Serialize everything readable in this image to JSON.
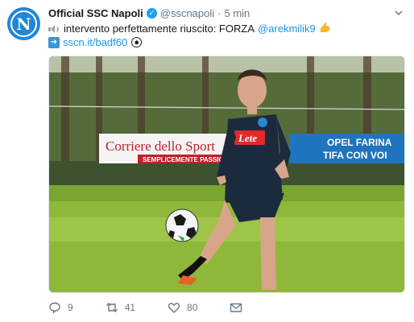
{
  "tweet": {
    "display_name": "Official SSC Napoli",
    "handle": "@sscnapoli",
    "separator": "·",
    "time": "5 min",
    "avatar_letter": "N",
    "text_line1": "intervento perfettamente riuscito: FORZA",
    "mention": "@arekmilik9",
    "link": "sscn.it/badf60"
  },
  "media": {
    "banner_left": "Corriere dello Sport",
    "banner_left_sub": "SEMPLICEMENTE PASSIONE",
    "banner_right_line1": "OPEL FARINA",
    "banner_right_line2": "TIFA CON VOI",
    "shirt_sponsor": "Lete"
  },
  "actions": {
    "replies": "9",
    "retweets": "41",
    "likes": "80"
  },
  "colors": {
    "link": "#1b95e0",
    "muted": "#657786",
    "brand": "#1f87d6",
    "verified": "#1da1f2"
  }
}
